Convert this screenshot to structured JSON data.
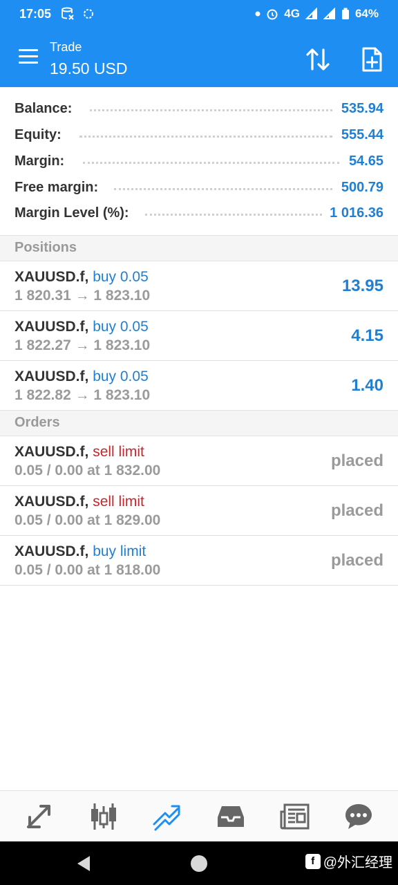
{
  "status_bar": {
    "time": "17:05",
    "network": "4G",
    "battery": "64%"
  },
  "app_bar": {
    "title": "Trade",
    "subtitle": "19.50 USD",
    "accent_color": "#1f8ef2"
  },
  "summary": [
    {
      "label": "Balance:",
      "value": "535.94"
    },
    {
      "label": "Equity:",
      "value": "555.44"
    },
    {
      "label": "Margin:",
      "value": "54.65"
    },
    {
      "label": "Free margin:",
      "value": "500.79"
    },
    {
      "label": "Margin Level (%):",
      "value": "1 016.36"
    }
  ],
  "positions": {
    "header": "Positions",
    "items": [
      {
        "symbol": "XAUUSD.f,",
        "side": "buy 0.05",
        "prices": "1 820.31 → 1 823.10",
        "profit": "13.95"
      },
      {
        "symbol": "XAUUSD.f,",
        "side": "buy 0.05",
        "prices": "1 822.27 → 1 823.10",
        "profit": "4.15"
      },
      {
        "symbol": "XAUUSD.f,",
        "side": "buy 0.05",
        "prices": "1 822.82 → 1 823.10",
        "profit": "1.40"
      }
    ]
  },
  "orders": {
    "header": "Orders",
    "items": [
      {
        "symbol": "XAUUSD.f,",
        "side": "sell limit",
        "details": "0.05 / 0.00 at 1 832.00",
        "status": "placed"
      },
      {
        "symbol": "XAUUSD.f,",
        "side": "sell limit",
        "details": "0.05 / 0.00 at 1 829.00",
        "status": "placed"
      },
      {
        "symbol": "XAUUSD.f,",
        "side": "buy limit",
        "details": "0.05 / 0.00 at 1 818.00",
        "status": "placed"
      }
    ]
  },
  "bottom_nav": [
    {
      "icon": "quotes-icon",
      "active": false
    },
    {
      "icon": "chart-icon",
      "active": false
    },
    {
      "icon": "trade-icon",
      "active": true
    },
    {
      "icon": "history-icon",
      "active": false
    },
    {
      "icon": "news-icon",
      "active": false
    },
    {
      "icon": "chat-icon",
      "active": false
    }
  ],
  "watermark": {
    "text": "@外汇经理"
  },
  "colors": {
    "buy": "#1f7fd3",
    "sell": "#c9252b",
    "muted": "#9a9a9a"
  }
}
